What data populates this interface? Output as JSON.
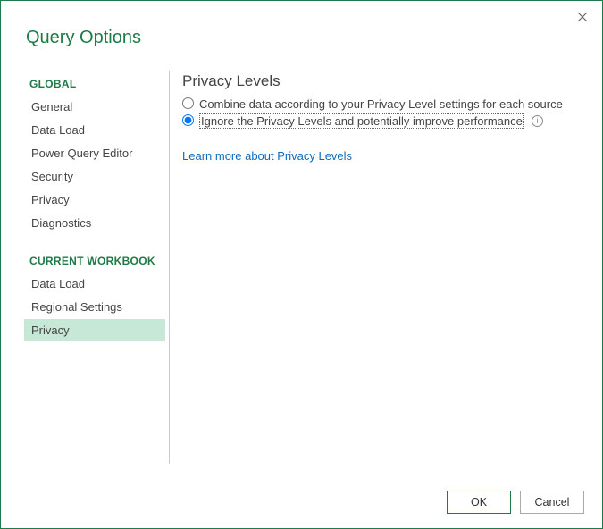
{
  "dialog": {
    "title": "Query Options"
  },
  "sidebar": {
    "global_header": "GLOBAL",
    "global_items": [
      {
        "label": "General"
      },
      {
        "label": "Data Load"
      },
      {
        "label": "Power Query Editor"
      },
      {
        "label": "Security"
      },
      {
        "label": "Privacy"
      },
      {
        "label": "Diagnostics"
      }
    ],
    "workbook_header": "CURRENT WORKBOOK",
    "workbook_items": [
      {
        "label": "Data Load"
      },
      {
        "label": "Regional Settings"
      },
      {
        "label": "Privacy"
      }
    ],
    "selected": "workbook.2"
  },
  "content": {
    "heading": "Privacy Levels",
    "options": [
      {
        "label": "Combine data according to your Privacy Level settings for each source",
        "selected": false
      },
      {
        "label": "Ignore the Privacy Levels and potentially improve performance",
        "selected": true,
        "info": true
      }
    ],
    "link": "Learn more about Privacy Levels"
  },
  "footer": {
    "ok": "OK",
    "cancel": "Cancel"
  }
}
